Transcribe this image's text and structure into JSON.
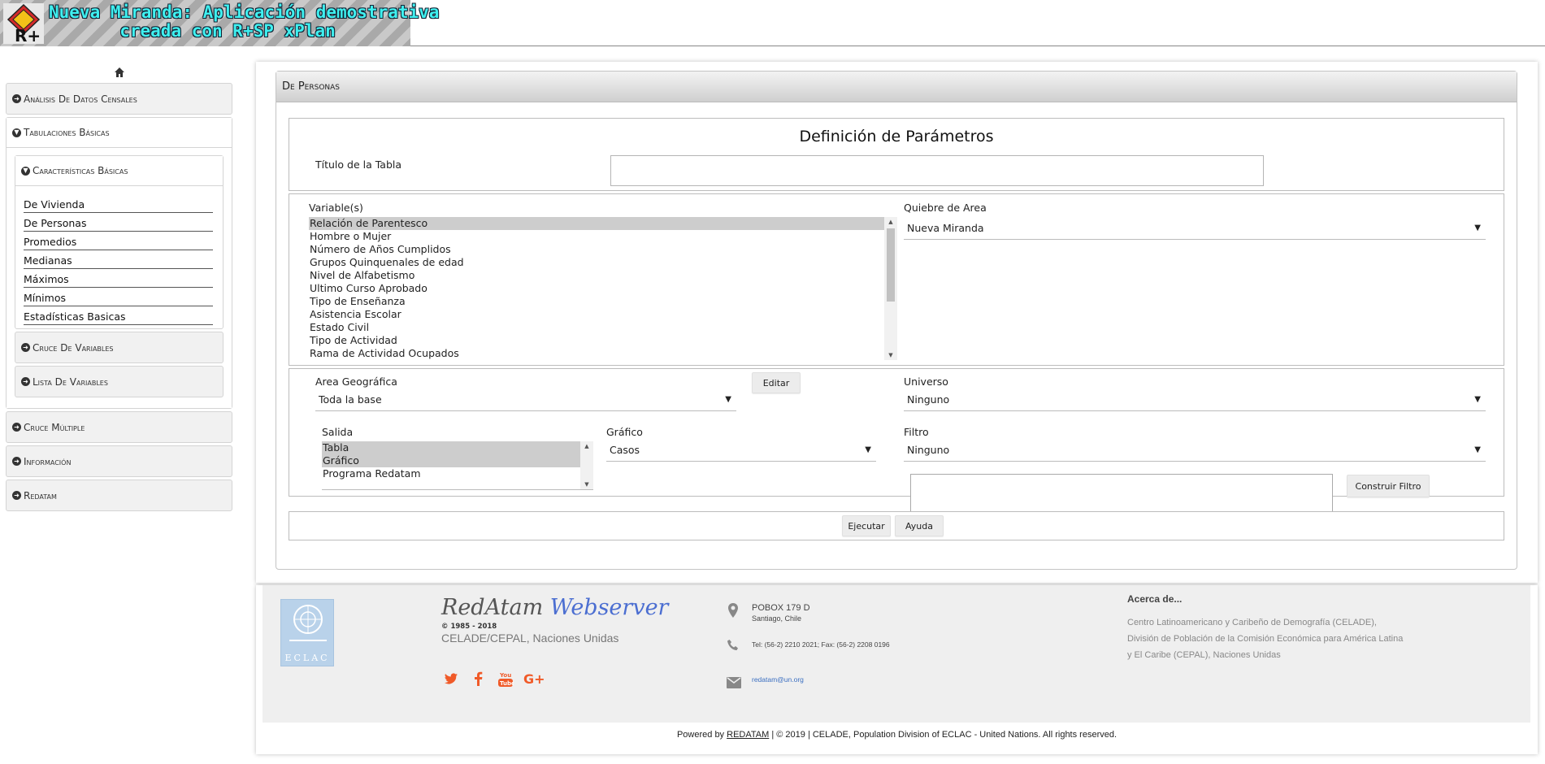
{
  "header": {
    "title_line1": "Nueva Miranda: Aplicación demostrativa",
    "title_line2": "creada con R+SP xPlan",
    "logo_text": "R+"
  },
  "sidebar": {
    "home_icon": "home-icon",
    "sections": [
      {
        "label": "Análisis De Datos Censales"
      },
      {
        "label": "Tabulaciones Básicas"
      },
      {
        "label": "Cruce Múltiple"
      },
      {
        "label": "Información"
      },
      {
        "label": "Redatam"
      }
    ],
    "tabulaciones": {
      "sub_sections": [
        {
          "label": "Características Básicas"
        },
        {
          "label": "Cruce De Variables"
        },
        {
          "label": "Lista De Variables"
        }
      ],
      "items": [
        "De Vivienda",
        "De Personas",
        "Promedios",
        "Medianas",
        "Máximos",
        "Mínimos",
        "Estadísticas Basicas"
      ]
    }
  },
  "panel": {
    "heading": "De Personas",
    "params_title": "Definición de Parámetros",
    "titulo_label": "Título de la Tabla",
    "titulo_value": "",
    "variables_label": "Variable(s)",
    "variables": [
      "Relación de Parentesco",
      "Hombre o Mujer",
      "Número de Años Cumplidos",
      "Grupos Quinquenales de edad",
      "Nivel de Alfabetismo",
      "Ultimo Curso Aprobado",
      "Tipo de Enseñanza",
      "Asistencia Escolar",
      "Estado Civil",
      "Tipo de Actividad",
      "Rama de Actividad Ocupados"
    ],
    "quiebre_label": "Quiebre de Area",
    "quiebre_value": "Nueva Miranda",
    "area_label": "Area Geográfica",
    "area_value": "Toda la base",
    "editar_button": "Editar",
    "universo_label": "Universo",
    "universo_value": "Ninguno",
    "salida_label": "Salida",
    "salida_options": [
      "Tabla",
      "Gráfico",
      "Programa Redatam"
    ],
    "grafico_label": "Gráfico",
    "grafico_value": "Casos",
    "filtro_label": "Filtro",
    "filtro_value": "Ninguno",
    "construir_button": "Construir Filtro",
    "ejecutar_button": "Ejecutar",
    "ayuda_button": "Ayuda"
  },
  "footer": {
    "brand_part1": "RedAtam",
    "brand_part2": "Webserver",
    "copyright_years": "© 1985 - 2018",
    "org": "CELADE/CEPAL, Naciones Unidas",
    "un_logo_text": "ECLAC",
    "address_line1": "POBOX 179 D",
    "address_line2": "Santiago, Chile",
    "phone": "Tel: (56-2) 2210 2021; Fax: (56-2) 2208 0196",
    "email": "redatam@un.org",
    "about_heading": "Acerca de...",
    "about_text": "Centro Latinoamericano y Caribeño de Demografía (CELADE), División de Población de la Comisión Económica para América Latina y El Caribe (CEPAL), Naciones Unidas",
    "bottom_prefix": "Powered by",
    "bottom_link": "REDATAM",
    "bottom_suffix": "| © 2019 | CELADE, Population Division of ECLAC - United Nations. All rights reserved.",
    "social_icons": [
      "twitter-icon",
      "facebook-icon",
      "youtube-icon",
      "google-plus-icon"
    ],
    "accent_color": "#f05a28"
  }
}
